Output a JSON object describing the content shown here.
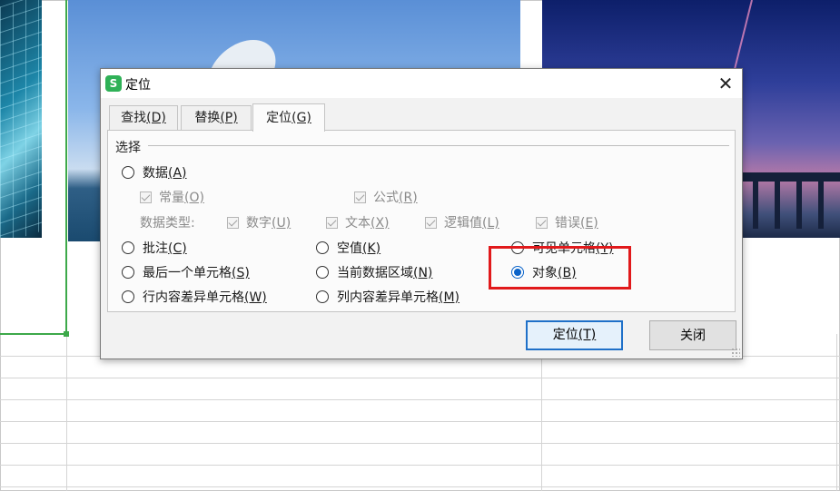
{
  "dialog": {
    "app_icon": "S",
    "title": "定位",
    "close_glyph": "✕",
    "tabs": [
      {
        "label": "查找",
        "key": "(D)"
      },
      {
        "label": "替换",
        "key": "(P)"
      },
      {
        "label": "定位",
        "key": "(G)"
      }
    ],
    "section_title": "选择",
    "options": {
      "data": {
        "label": "数据",
        "key": "(A)",
        "selected": false
      },
      "constant": {
        "label": "常量",
        "key": "(O)",
        "checked": true
      },
      "formula": {
        "label": "公式",
        "key": "(R)",
        "checked": true
      },
      "data_type_label": "数据类型:",
      "number": {
        "label": "数字",
        "key": "(U)",
        "checked": true
      },
      "text": {
        "label": "文本",
        "key": "(X)",
        "checked": true
      },
      "logical": {
        "label": "逻辑值",
        "key": "(L)",
        "checked": true
      },
      "error": {
        "label": "错误",
        "key": "(E)",
        "checked": true
      },
      "comment": {
        "label": "批注",
        "key": "(C)",
        "selected": false
      },
      "blank": {
        "label": "空值",
        "key": "(K)",
        "selected": false
      },
      "visible": {
        "label": "可见单元格",
        "key": "(Y)",
        "selected": false
      },
      "last_cell": {
        "label": "最后一个单元格",
        "key": "(S)",
        "selected": false
      },
      "current_region": {
        "label": "当前数据区域",
        "key": "(N)",
        "selected": false
      },
      "object": {
        "label": "对象",
        "key": "(B)",
        "selected": true
      },
      "row_diff": {
        "label": "行内容差异单元格",
        "key": "(W)",
        "selected": false
      },
      "col_diff": {
        "label": "列内容差异单元格",
        "key": "(M)",
        "selected": false
      }
    },
    "buttons": {
      "locate": {
        "label": "定位",
        "key": "(T)"
      },
      "close": {
        "label": "关闭"
      }
    }
  },
  "colors": {
    "highlight_box": "#e1191b",
    "selection_accent": "#3da94a",
    "radio_selected": "#0a63c9",
    "app_icon": "#2fb157"
  }
}
